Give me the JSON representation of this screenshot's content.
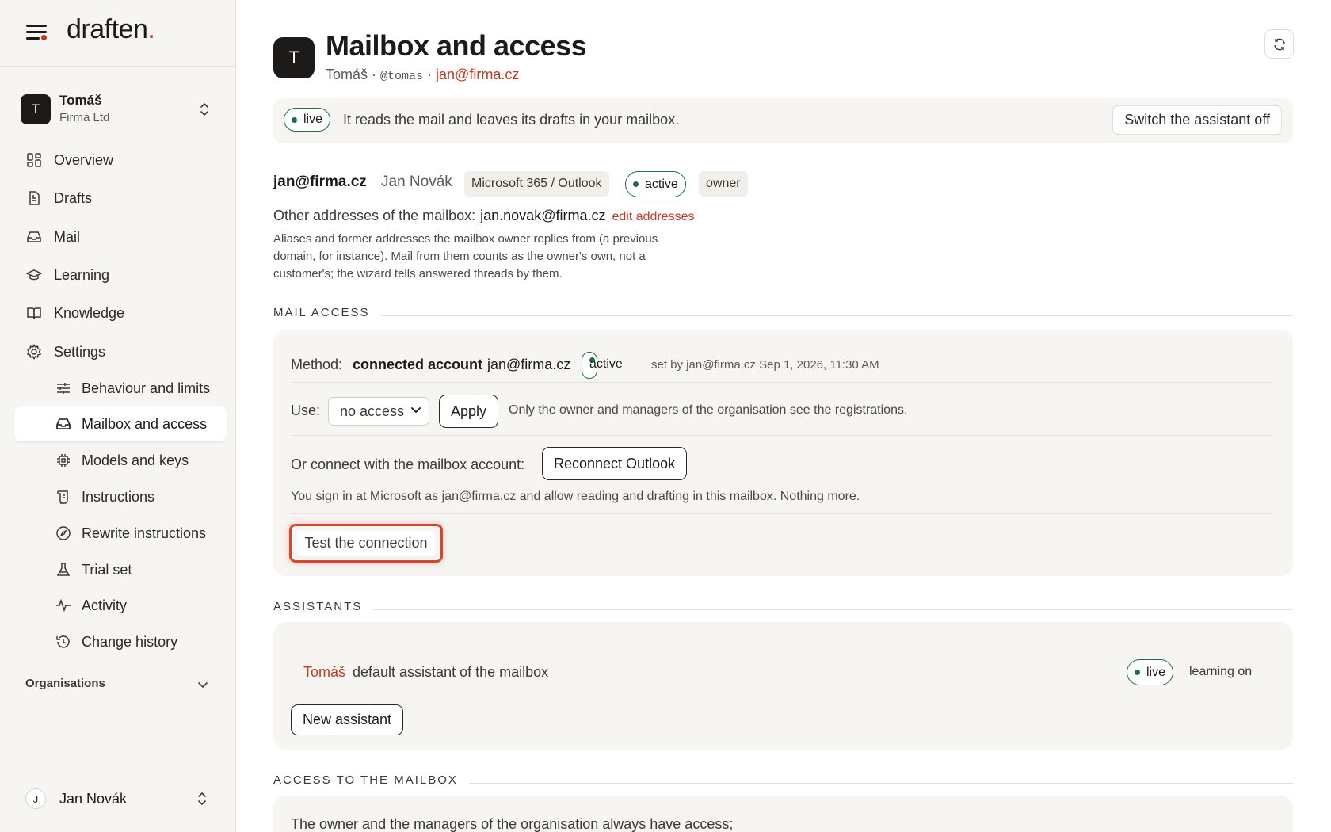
{
  "brand": {
    "name": "draften",
    "dot": "."
  },
  "account": {
    "initial": "T",
    "name": "Tomáš",
    "org": "Firma Ltd"
  },
  "nav": {
    "overview": "Overview",
    "drafts": "Drafts",
    "mail": "Mail",
    "learning": "Learning",
    "knowledge": "Knowledge",
    "settings": "Settings",
    "behaviour": "Behaviour and limits",
    "mailbox": "Mailbox and access",
    "models": "Models and keys",
    "instructions": "Instructions",
    "rewrite": "Rewrite instructions",
    "trial": "Trial set",
    "activity": "Activity",
    "history": "Change history"
  },
  "organisations_label": "Organisations",
  "user": {
    "initial": "J",
    "name": "Jan Novák"
  },
  "page": {
    "avatar": "T",
    "title": "Mailbox and access",
    "sub_name": "Tomáš · ",
    "sub_handle": "@tomas",
    "sub_sep": " · ",
    "sub_email": "jan@firma.cz"
  },
  "banner": {
    "status": "live",
    "message": "It reads the mail and leaves its drafts in your mailbox.",
    "off_button": "Switch the assistant off"
  },
  "identity": {
    "email": "jan@firma.cz",
    "name": "Jan Novák",
    "provider": "Microsoft 365 / Outlook",
    "status": "active",
    "role": "owner"
  },
  "other_addresses": {
    "label": "Other addresses of the mailbox:",
    "value": "jan.novak@firma.cz",
    "edit": "edit addresses",
    "note": "Aliases and former addresses the mailbox owner replies from (a previous domain, for instance). Mail from them counts as the owner's own, not a customer's; the wizard tells answered threads by them."
  },
  "mail_access": {
    "section": "MAIL ACCESS",
    "method_label": "Method:",
    "method_value": "connected account",
    "method_email": "jan@firma.cz",
    "status": "active",
    "set_by": "set by jan@firma.cz Sep 1, 2026, 11:30 AM",
    "use_label": "Use:",
    "use_value": "no access",
    "apply": "Apply",
    "use_note": "Only the owner and managers of the organisation see the registrations.",
    "connect_label": "Or connect with the mailbox account:",
    "reconnect": "Reconnect Outlook",
    "connect_note": "You sign in at Microsoft as jan@firma.cz and allow reading and drafting in this mailbox. Nothing more.",
    "test": "Test the connection"
  },
  "assistants": {
    "section": "ASSISTANTS",
    "name": "Tomáš",
    "desc": "default assistant of the mailbox",
    "status": "live",
    "learning": "learning on",
    "new": "New assistant"
  },
  "access": {
    "section": "ACCESS TO THE MAILBOX",
    "text": "The owner and the managers of the organisation always have access;"
  },
  "colors": {
    "accent": "#c23a22",
    "live": "#1f6b4a",
    "highlight": "#d24a2e"
  }
}
